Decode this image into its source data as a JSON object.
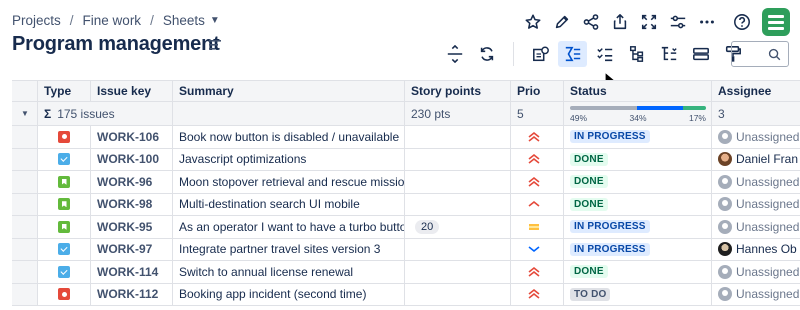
{
  "breadcrumb": {
    "projects": "Projects",
    "separator": "/",
    "project": "Fine work",
    "section": "Sheets"
  },
  "page_title": "Program management",
  "search": {
    "placeholder": "",
    "value": ""
  },
  "grid": {
    "columns": [
      "Type",
      "Issue key",
      "Summary",
      "Story points",
      "Prio",
      "Status",
      "Assignee"
    ],
    "summary_row": {
      "sigma": "Σ",
      "issues": "175 issues",
      "points": "230 pts",
      "prio": "5",
      "status_percentages": [
        "49%",
        "34%",
        "17%"
      ],
      "status_fractions": [
        0.49,
        0.34,
        0.17
      ],
      "status_colors": [
        "#a5adba",
        "#0065ff",
        "#36b37e"
      ],
      "assignee": "3"
    },
    "rows": [
      {
        "type": "bug",
        "key": "WORK-106",
        "summary": "Book now button is disabled / unavailable",
        "points": "",
        "prio": "high",
        "status": "IN PROGRESS",
        "status_style": "blue",
        "assignee": "Unassigned",
        "avatar": "unassigned"
      },
      {
        "type": "task",
        "key": "WORK-100",
        "summary": "Javascript optimizations",
        "points": "",
        "prio": "high",
        "status": "DONE",
        "status_style": "green",
        "assignee": "Daniel Fran",
        "avatar": "photo1"
      },
      {
        "type": "story",
        "key": "WORK-96",
        "summary": "Moon stopover retrieval and rescue missio…",
        "points": "",
        "prio": "high",
        "status": "DONE",
        "status_style": "green",
        "assignee": "Unassigned",
        "avatar": "unassigned"
      },
      {
        "type": "story",
        "key": "WORK-98",
        "summary": "Multi-destination search UI mobile",
        "points": "",
        "prio": "medium-high",
        "status": "DONE",
        "status_style": "green",
        "assignee": "Unassigned",
        "avatar": "unassigned"
      },
      {
        "type": "story",
        "key": "WORK-95",
        "summary": "As an operator I want to have a turbo button",
        "points": "20",
        "prio": "medium",
        "status": "IN PROGRESS",
        "status_style": "blue",
        "assignee": "Unassigned",
        "avatar": "unassigned"
      },
      {
        "type": "task",
        "key": "WORK-97",
        "summary": "Integrate partner travel sites version 3",
        "points": "",
        "prio": "low",
        "status": "IN PROGRESS",
        "status_style": "blue",
        "assignee": "Hannes Ob",
        "avatar": "photo2"
      },
      {
        "type": "task",
        "key": "WORK-114",
        "summary": "Switch to annual license renewal",
        "points": "",
        "prio": "high",
        "status": "DONE",
        "status_style": "green",
        "assignee": "Unassigned",
        "avatar": "unassigned"
      },
      {
        "type": "bug",
        "key": "WORK-112",
        "summary": "Booking app incident (second time)",
        "points": "",
        "prio": "high",
        "status": "TO DO",
        "status_style": "gray",
        "assignee": "Unassigned",
        "avatar": "unassigned"
      }
    ]
  },
  "colors": {
    "accent": "#0052cc",
    "logo": "#2e9e5b",
    "prio_high": "#e5493a",
    "prio_medium": "#ffab00",
    "prio_low": "#0065ff"
  },
  "icons": {
    "top_toolbar": [
      "star-icon",
      "pencil-icon",
      "share-icon",
      "export-icon",
      "fullscreen-icon",
      "settings-sliders-icon",
      "more-icon",
      "help-icon",
      "app-logo"
    ],
    "sheet_toolbar": [
      "row-height-icon",
      "refresh-icon",
      "card-view-icon",
      "sum-icon",
      "checklist-icon",
      "hierarchy-icon",
      "tree-icon",
      "rows-icon",
      "format-painter-icon"
    ]
  }
}
